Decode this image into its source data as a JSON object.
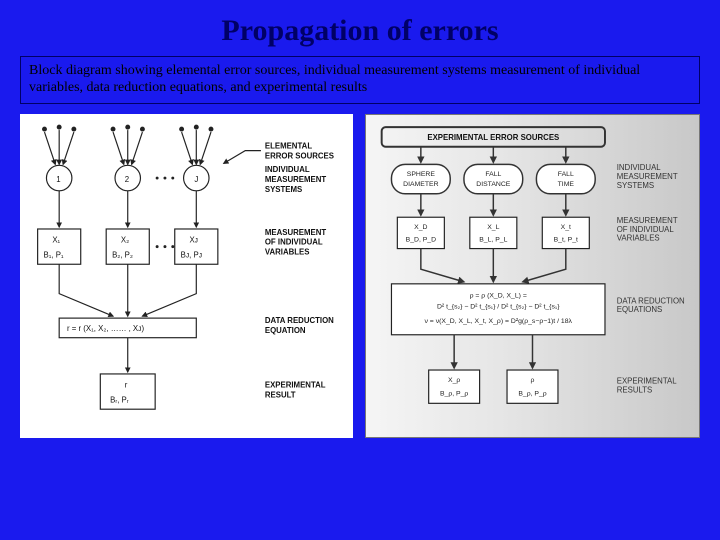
{
  "title": "Propagation of errors",
  "description": "Block diagram showing elemental error sources, individual measurement systems measurement of individual variables, data reduction equations, and experimental results",
  "left": {
    "row_labels": {
      "elemental": "ELEMENTAL\nERROR SOURCES",
      "systems": "INDIVIDUAL\nMEASUREMENT\nSYSTEMS",
      "vars": "MEASUREMENT\nOF INDIVIDUAL\nVARIABLES",
      "reduction": "DATA REDUCTION\nEQUATION",
      "result": "EXPERIMENTAL\nRESULT"
    },
    "systems": [
      "1",
      "2",
      "J"
    ],
    "vars": [
      {
        "x": "X₁",
        "bp": "B₁, P₁"
      },
      {
        "x": "X₂",
        "bp": "B₂, P₂"
      },
      {
        "x": "Xᴊ",
        "bp": "Bᴊ, Pᴊ"
      }
    ],
    "reduction": "r = r (X₁, X₂, …… , Xᴊ)",
    "result": {
      "r": "r",
      "bp": "Bᵣ, Pᵣ"
    }
  },
  "right": {
    "header": "EXPERIMENTAL ERROR SOURCES",
    "systems": [
      "SPHERE\nDIAMETER",
      "FALL\nDISTANCE",
      "FALL\nTIME"
    ],
    "vars": [
      {
        "x": "X_D",
        "bp": "B_D, P_D"
      },
      {
        "x": "X_L",
        "bp": "B_L, P_L"
      },
      {
        "x": "X_t",
        "bp": "B_t, P_t"
      }
    ],
    "reduction": [
      "ρ = ρ (X_D, X_L) = (D² t_{s₂} − D² t_{s₁}) / (D² t_{s₂} − D² t_{s₁})",
      "ν = ν(X_D, X_L, X_t, X_ρ) = D² g(ρ_{sphere}−ρ−1)t / 18λ"
    ],
    "results": [
      {
        "top": "X_ρ",
        "bot": "B_ρ, P_ρ"
      },
      {
        "top": "ρ",
        "bot": "B_ρ, P_ρ"
      }
    ],
    "row_labels": {
      "systems": "INDIVIDUAL\nMEASUREMENT\nSYSTEMS",
      "vars": "MEASUREMENT\nOF INDIVIDUAL\nVARIABLES",
      "reduction": "DATA REDUCTION\nEQUATIONS",
      "result": "EXPERIMENTAL\nRESULTS"
    }
  }
}
